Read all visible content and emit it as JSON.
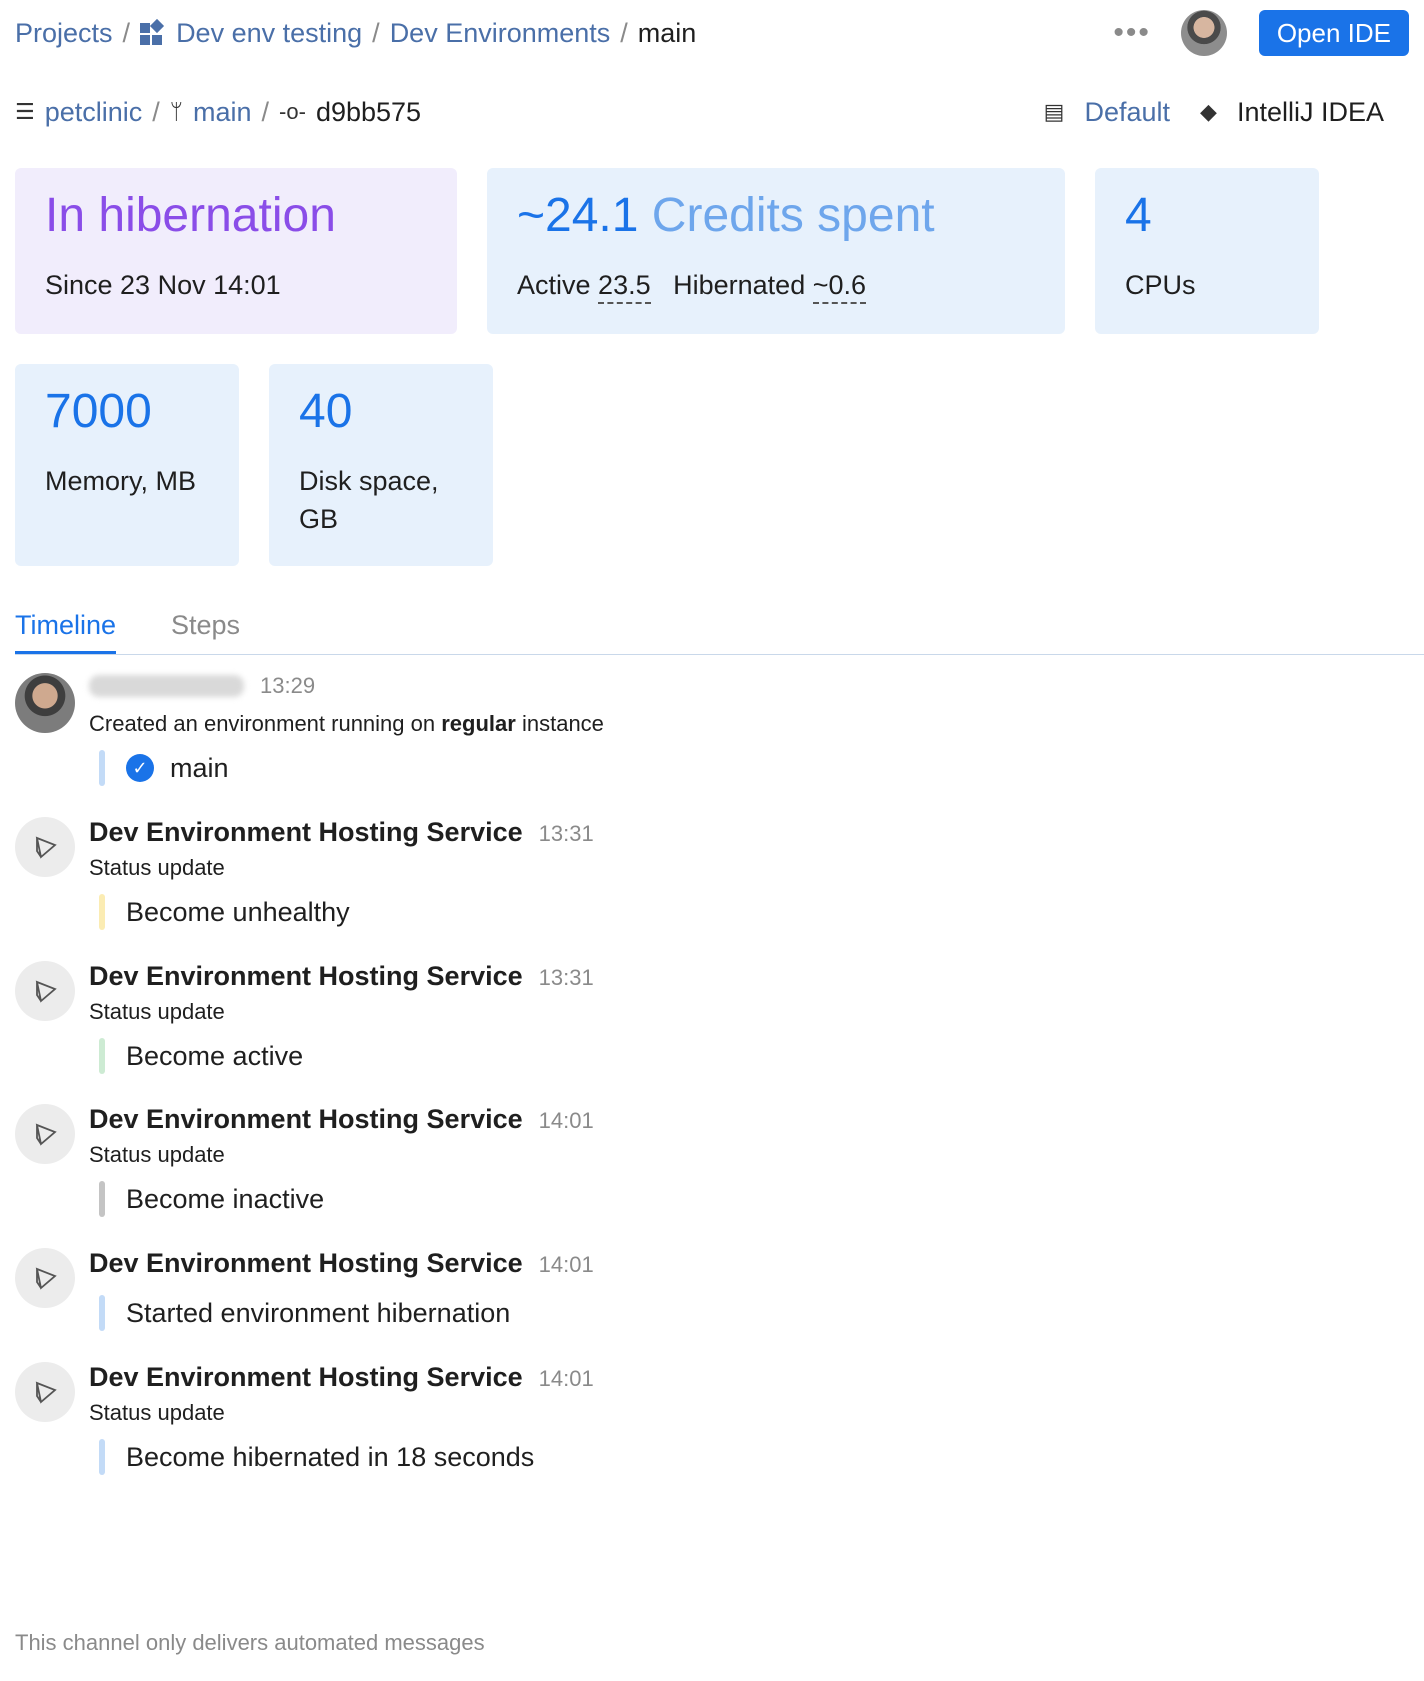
{
  "breadcrumb": {
    "projects": "Projects",
    "project": "Dev env testing",
    "section": "Dev Environments",
    "current": "main",
    "separator": "/"
  },
  "header": {
    "more_label": "•••",
    "open_ide_label": "Open IDE"
  },
  "repo": {
    "name": "petclinic",
    "branch": "main",
    "commit": "d9bb575",
    "warmup": "Default",
    "ide": "IntelliJ IDEA"
  },
  "stats": {
    "state": "In hibernation",
    "state_since": "Since 23 Nov 14:01",
    "credits_value": "~24.1",
    "credits_label": "Credits spent",
    "active_label": "Active",
    "active_value": "23.5",
    "hibernated_label": "Hibernated",
    "hibernated_value": "~0.6",
    "cpus_value": "4",
    "cpus_label": "CPUs",
    "memory_value": "7000",
    "memory_label": "Memory, MB",
    "disk_value": "40",
    "disk_label_1": "Disk space,",
    "disk_label_2": "GB"
  },
  "tabs": [
    {
      "label": "Timeline",
      "active": true
    },
    {
      "label": "Steps",
      "active": false
    }
  ],
  "timeline": {
    "created": {
      "time": "13:29",
      "desc_prefix": "Created an environment running on",
      "desc_bold": "regular",
      "desc_suffix": "instance",
      "branch": "main"
    },
    "entries": [
      {
        "author": "Dev Environment Hosting Service",
        "time": "13:31",
        "desc": "Status update",
        "text": "Become unhealthy",
        "color": "#fbecb3"
      },
      {
        "author": "Dev Environment Hosting Service",
        "time": "13:31",
        "desc": "Status update",
        "text": "Become active",
        "color": "#cdebd3"
      },
      {
        "author": "Dev Environment Hosting Service",
        "time": "14:01",
        "desc": "Status update",
        "text": "Become inactive",
        "color": "#c4c4c4"
      },
      {
        "author": "Dev Environment Hosting Service",
        "time": "14:01",
        "desc": "",
        "text": "Started environment hibernation",
        "color": "#c3dbf7"
      },
      {
        "author": "Dev Environment Hosting Service",
        "time": "14:01",
        "desc": "Status update",
        "text": "Become hibernated in 18 seconds",
        "color": "#c3dbf7"
      }
    ]
  },
  "footer": "This channel only delivers automated messages",
  "colors": {
    "accent": "#1a73e8",
    "hibernation": "#8a4de8",
    "link": "#4a6fa8"
  }
}
